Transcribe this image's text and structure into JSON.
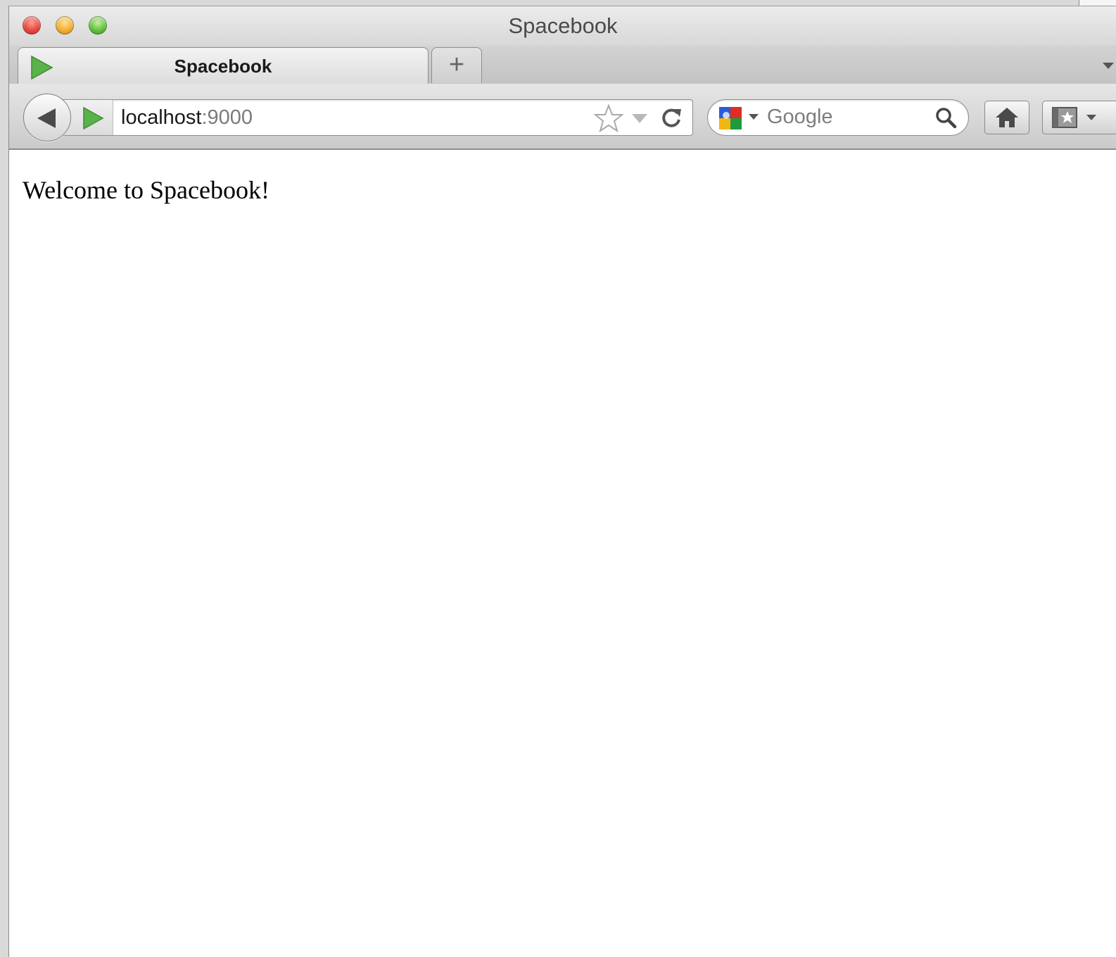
{
  "window": {
    "title": "Spacebook"
  },
  "tabs": [
    {
      "label": "Spacebook",
      "active": true,
      "icon": "play-favicon-icon"
    }
  ],
  "tabstrip": {
    "new_tab_label": "+"
  },
  "navbar": {
    "url_host": "localhost",
    "url_port": ":9000",
    "search_placeholder": "Google",
    "search_engine_icon": "google-logo-icon"
  },
  "content": {
    "welcome_text": "Welcome to Spacebook!"
  },
  "colors": {
    "favicon_green": "#5ab34a",
    "close_red": "#e5453a",
    "minimize_yellow": "#f2ad2c",
    "maximize_green": "#5fbf3c"
  }
}
